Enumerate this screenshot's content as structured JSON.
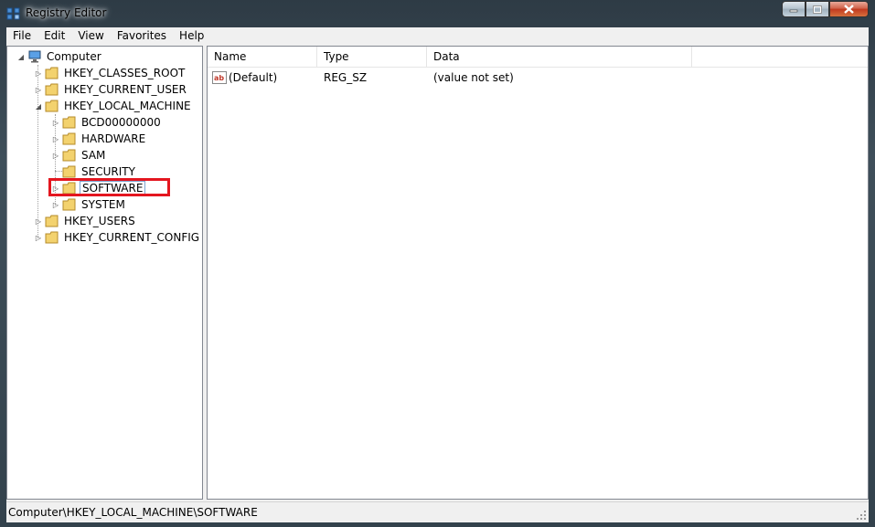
{
  "window": {
    "title": "Registry Editor",
    "buttons": {
      "minimize": "minimize-icon",
      "maximize": "maximize-icon",
      "close": "close-icon"
    }
  },
  "menu": [
    "File",
    "Edit",
    "View",
    "Favorites",
    "Help"
  ],
  "tree": {
    "root": "Computer",
    "hives": [
      "HKEY_CLASSES_ROOT",
      "HKEY_CURRENT_USER",
      "HKEY_LOCAL_MACHINE",
      "HKEY_USERS",
      "HKEY_CURRENT_CONFIG"
    ],
    "hklm_children": [
      "BCD00000000",
      "HARDWARE",
      "SAM",
      "SECURITY",
      "SOFTWARE",
      "SYSTEM"
    ],
    "selected": "SOFTWARE",
    "highlight_color": "#e4161f"
  },
  "list": {
    "columns": [
      "Name",
      "Type",
      "Data"
    ],
    "rows": [
      {
        "icon": "string-value-icon",
        "name": "(Default)",
        "type": "REG_SZ",
        "data": "(value not set)"
      }
    ]
  },
  "status": {
    "path": "Computer\\HKEY_LOCAL_MACHINE\\SOFTWARE"
  }
}
